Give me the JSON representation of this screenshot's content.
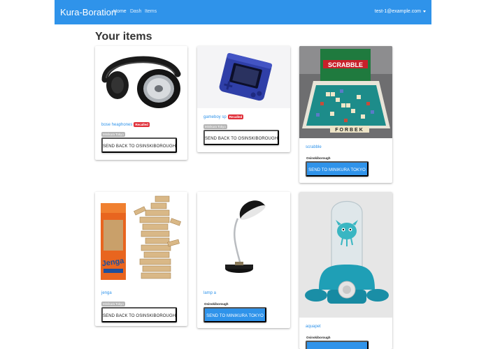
{
  "navbar": {
    "brand": "Kura-Boration",
    "links": [
      "Home",
      "Dash",
      "Items"
    ],
    "user_email": "test-1@example.com"
  },
  "page": {
    "title": "Your items"
  },
  "items": [
    {
      "name": "bose heaphones",
      "recalled": "Recalled",
      "location": "Minikura Tokyo",
      "action": "SEND BACK TO OSINSKIBOROUGH"
    },
    {
      "name": "gameboy sp",
      "recalled": "Recalled",
      "location": "Minikura Tokyo",
      "action": "SEND BACK TO OSINSKIBOROUGH"
    },
    {
      "name": "scrabble",
      "location": "Osinskiborough",
      "action": "SEND TO MINIKURA TOKYO"
    },
    {
      "name": "jenga",
      "location": "Minikura Tokyo",
      "action": "SEND BACK TO OSINSKIBOROUGH"
    },
    {
      "name": "lamp a",
      "location": "Osinskiborough",
      "action": "SEND TO MINIKURA TOKYO"
    },
    {
      "name": "aquapet",
      "location": "Osinskiborough",
      "action": ""
    }
  ],
  "images": {
    "scrabble_brand": "SCRABBLE",
    "scrabble_tiles": "FORBEK",
    "jenga_brand": "Jenga"
  },
  "colors": {
    "primary": "#2f93ea",
    "recalled": "#e0303a",
    "tag_grey": "#b5b5b5"
  }
}
